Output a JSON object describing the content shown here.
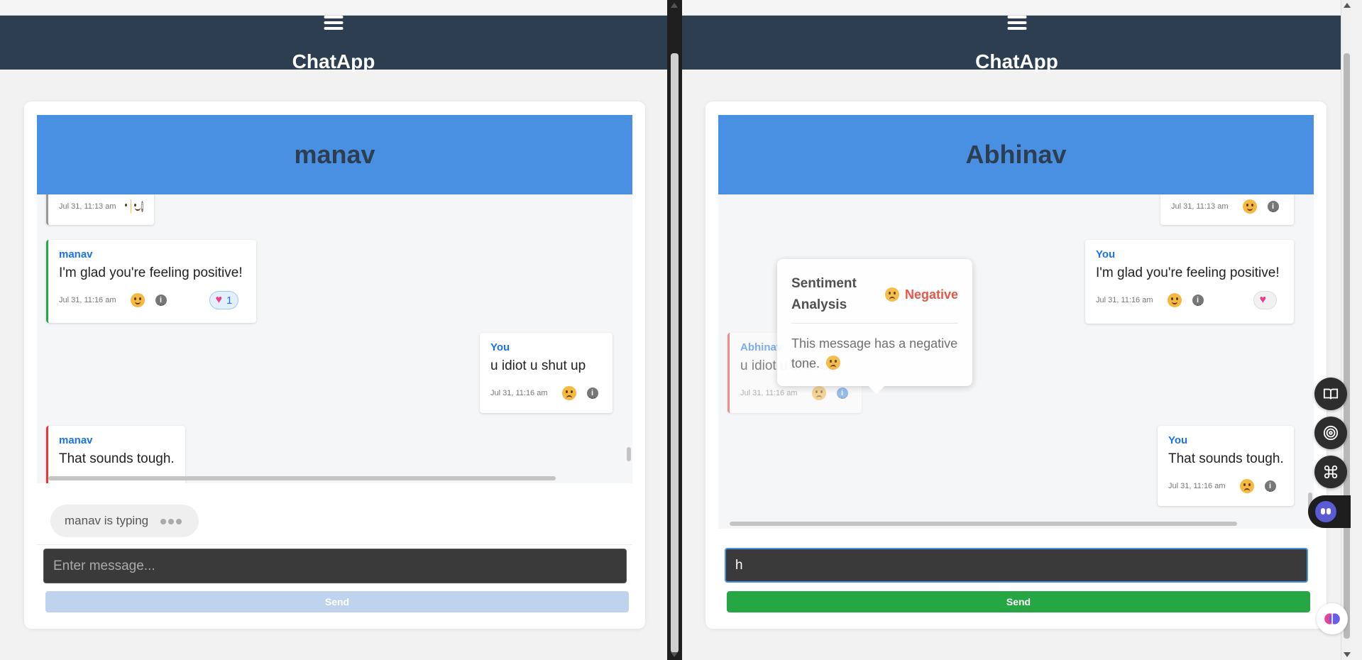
{
  "brand": "ChatApp",
  "colors": {
    "navbar": "#2d3e50",
    "chat_header": "#4a90e2",
    "positive_border": "#28a745",
    "negative_border": "#e53935",
    "neutral_border": "#999999",
    "send_enabled": "#27a744",
    "send_disabled": "#bfd3ef",
    "negative_label": "#e74c3c"
  },
  "left": {
    "contact": "manav",
    "messages": [
      {
        "time": "Jul 31, 11:13 am",
        "sentiment_icon": "neutral-face-icon"
      },
      {
        "sender": "manav",
        "text": "I'm glad you're feeling positive!",
        "time": "Jul 31, 11:16 am",
        "sentiment_icon": "smile-face-icon",
        "reaction_count": "1"
      },
      {
        "sender": "You",
        "text": "u idiot u shut up",
        "time": "Jul 31, 11:16 am",
        "sentiment_icon": "frown-face-icon"
      },
      {
        "sender": "manav",
        "text": "That sounds tough."
      }
    ],
    "typing_text": "manav is typing",
    "input_placeholder": "Enter message...",
    "send_label": "Send"
  },
  "right": {
    "contact": "Abhinav",
    "messages": [
      {
        "time": "Jul 31, 11:13 am",
        "sentiment_icon": "neutral-face-icon"
      },
      {
        "sender": "You",
        "text": "I'm glad you're feeling positive!",
        "time": "Jul 31, 11:16 am",
        "sentiment_icon": "smile-face-icon"
      },
      {
        "sender": "Abhinav",
        "text": "u idiot u shut up",
        "time": "Jul 31, 11:16 am",
        "sentiment_icon": "frown-face-icon"
      },
      {
        "sender": "You",
        "text": "That sounds tough.",
        "time": "Jul 31, 11:16 am",
        "sentiment_icon": "frown-face-icon"
      }
    ],
    "tooltip": {
      "title": "Sentiment Analysis",
      "label": "Negative",
      "body": "This message has a negative tone."
    },
    "input_value": "h",
    "send_label": "Send"
  },
  "extension_icons": [
    "book-icon",
    "broadcast-icon",
    "command-icon",
    "assistant-icon",
    "brain-icon"
  ]
}
